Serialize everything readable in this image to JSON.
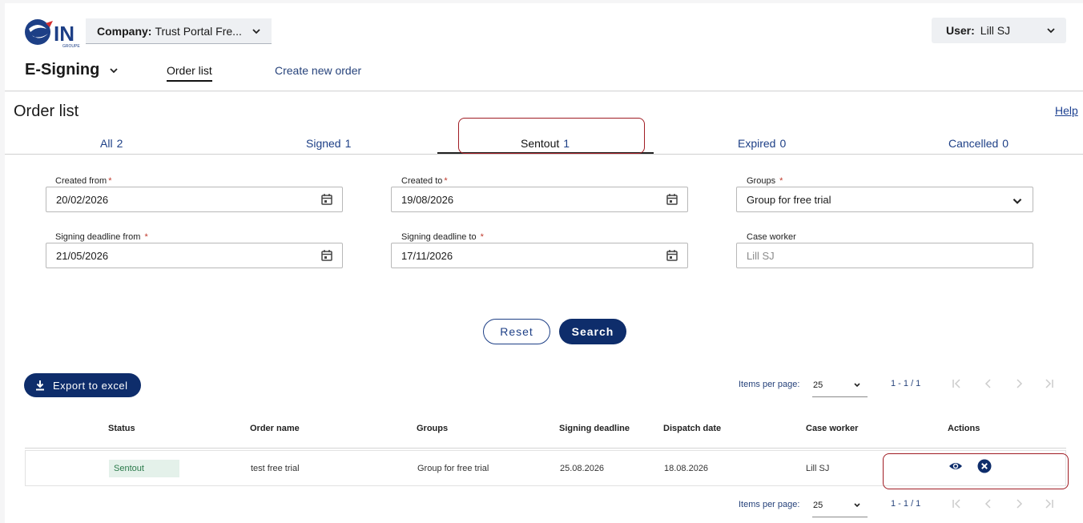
{
  "header": {
    "logo_text": "IN",
    "logo_sub": "GROUPE",
    "company_label": "Company:",
    "company_value": "Trust Portal Fre...",
    "user_label": "User:",
    "user_value": "Lill SJ",
    "app_title": "E-Signing",
    "nav": {
      "order_list": "Order list",
      "create_new_order": "Create new order"
    }
  },
  "page": {
    "title": "Order list",
    "help": "Help"
  },
  "tabs": [
    {
      "label": "All",
      "count": "2"
    },
    {
      "label": "Signed",
      "count": "1"
    },
    {
      "label": "Sentout",
      "count": "1"
    },
    {
      "label": "Expired",
      "count": "0"
    },
    {
      "label": "Cancelled",
      "count": "0"
    }
  ],
  "filters": {
    "created_from": {
      "label": "Created from",
      "value": "20/02/2026"
    },
    "created_to": {
      "label": "Created to",
      "value": "19/08/2026"
    },
    "groups": {
      "label": "Groups",
      "value": "Group for free trial"
    },
    "deadline_from": {
      "label": "Signing deadline from",
      "value": "21/05/2026"
    },
    "deadline_to": {
      "label": "Signing deadline to",
      "value": "17/11/2026"
    },
    "case_worker": {
      "label": "Case worker",
      "placeholder": "Lill SJ"
    },
    "required_mark": "*"
  },
  "buttons": {
    "reset": "Reset",
    "search": "Search",
    "export": "Export to excel"
  },
  "pager": {
    "items_per_page": "Items per page:",
    "page_size": "25",
    "range": "1 - 1 / 1"
  },
  "table": {
    "headers": [
      "Status",
      "Order name",
      "Groups",
      "Signing deadline",
      "Dispatch date",
      "Case worker",
      "Actions"
    ],
    "rows": [
      {
        "status": "Sentout",
        "order_name": "test free trial",
        "groups": "Group for free trial",
        "signing_deadline": "25.08.2026",
        "dispatch_date": "18.08.2026",
        "case_worker": "Lill SJ"
      }
    ]
  },
  "colors": {
    "primary": "#0e2d6b",
    "link": "#1d3f86",
    "highlight": "#a01c23",
    "status_bg": "#e4f1ea",
    "status_text": "#2b7a4b"
  }
}
